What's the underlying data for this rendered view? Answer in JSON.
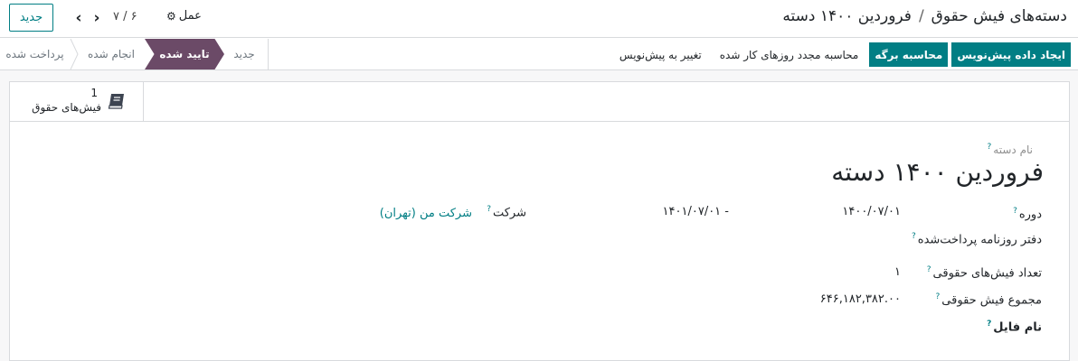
{
  "topbar": {
    "new_label": "جدید",
    "pager_value": "۷ / ۶",
    "action_label": "عمل",
    "breadcrumb_parent": "دسته‌های فیش حقوق",
    "breadcrumb_sep": "/",
    "breadcrumb_current": "فروردین ۱۴۰۰ دسته"
  },
  "statusbar": {
    "stages": [
      "پرداخت شده",
      "انجام شده",
      "تایید شده",
      "جدید"
    ],
    "active": "تایید شده"
  },
  "actions": {
    "create_draft": "ایجاد داده پیش‌نویس",
    "compute_sheet": "محاسبه برگه",
    "recompute_worked_days": "محاسبه مجدد روزهای کار شده",
    "set_to_draft": "تغییر به پیش‌نویس"
  },
  "stat_button": {
    "count": "1",
    "label": "فیش‌های حقوق",
    "icon": "book-icon"
  },
  "form": {
    "batch_name_label": "نام دسته",
    "title": "فروردین ۱۴۰۰ دسته",
    "period_label": "دوره",
    "period_start": "۱۴۰۰/۰۷/۰۱",
    "period_end": "- ۱۴۰۱/۰۷/۰۱",
    "company_label": "شرکت",
    "company_value": "شرکت من (تهران)",
    "journal_label": "دفتر روزنامه پرداخت‌شده",
    "payslip_count_label": "تعداد فیش‌های حقوقی",
    "payslip_count_value": "۱",
    "payslip_total_label": "مجموع فیش حقوقی",
    "payslip_total_value": "۶۴۶,۱۸۲,۳۸۲.۰۰",
    "file_name_label": "نام فایل",
    "help_mark": "?"
  },
  "colors": {
    "primary": "#017e84",
    "active_stage": "#6b4a67"
  }
}
